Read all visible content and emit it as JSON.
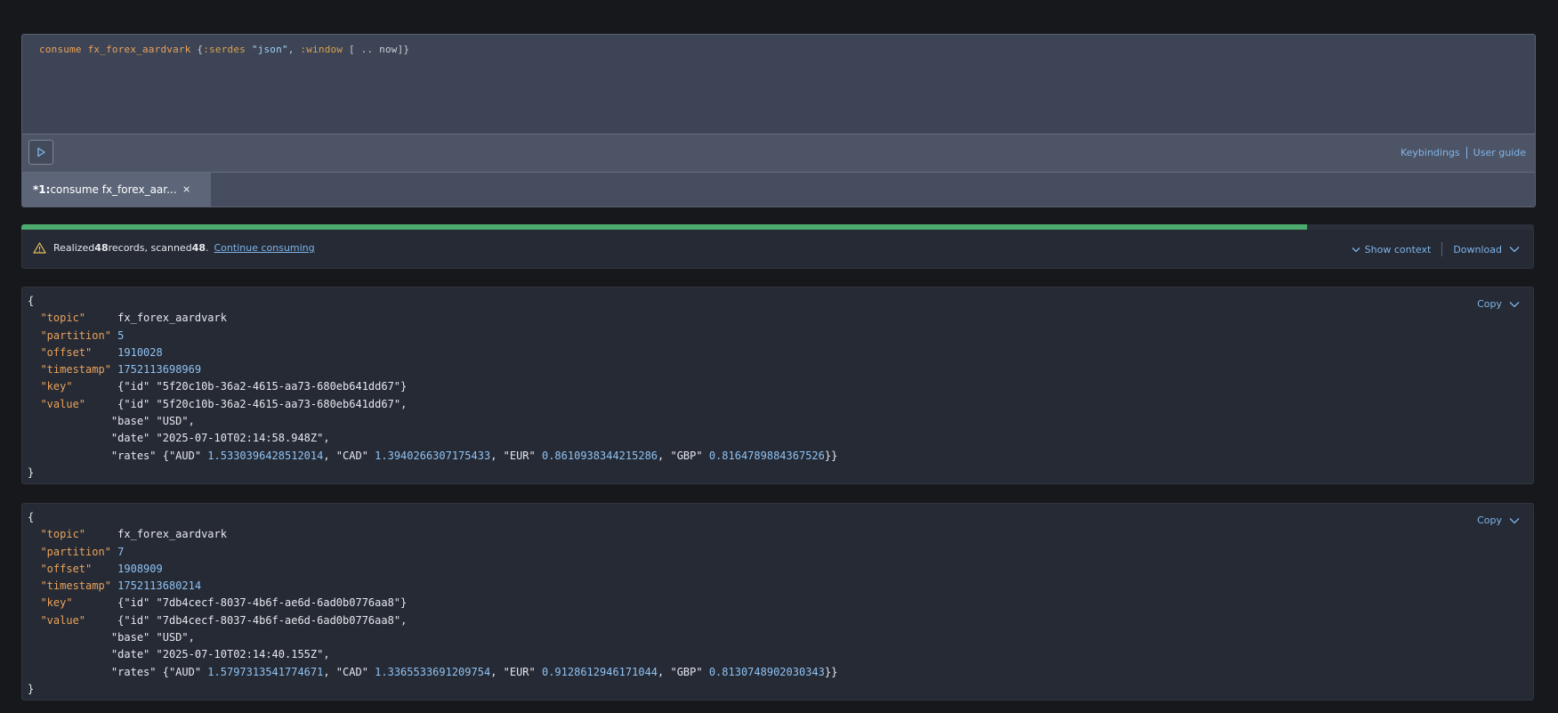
{
  "editor": {
    "query": {
      "kw": "consume fx_forex_aardvark",
      "open": " {",
      "serdes_key": ":serdes",
      "serdes_val": "\"json\"",
      "comma": ", ",
      "window_key": ":window",
      "window_val": " [ .. now]",
      "close": "}"
    },
    "run_icon": "play-icon",
    "links": {
      "keybindings": "Keybindings",
      "user_guide": "User guide"
    },
    "tab": {
      "prefix": "*1:",
      "label": " consume fx_forex_aar...",
      "close": "×"
    }
  },
  "progress": {
    "fraction": 0.85,
    "color": "#4caa6e"
  },
  "status": {
    "text_realized": "Realized ",
    "realized": "48",
    "text_scanned": " records, scanned ",
    "scanned": "48",
    "text_end": ".",
    "continue": "Continue consuming",
    "show_context": "Show context",
    "download": "Download"
  },
  "records": [
    {
      "copy": "Copy",
      "topic": "fx_forex_aardvark",
      "partition": "5",
      "offset": "1910028",
      "timestamp": "1752113698969",
      "key_id": "\"5f20c10b-36a2-4615-aa73-680eb641dd67\"",
      "value_id": "\"5f20c10b-36a2-4615-aa73-680eb641dd67\"",
      "base": "\"USD\"",
      "date": "\"2025-07-10T02:14:58.948Z\"",
      "aud": "1.5330396428512014",
      "cad": "1.3940266307175433",
      "eur": "0.8610938344215286",
      "gbp": "0.8164789884367526"
    },
    {
      "copy": "Copy",
      "topic": "fx_forex_aardvark",
      "partition": "7",
      "offset": "1908909",
      "timestamp": "1752113680214",
      "key_id": "\"7db4cecf-8037-4b6f-ae6d-6ad0b0776aa8\"",
      "value_id": "\"7db4cecf-8037-4b6f-ae6d-6ad0b0776aa8\"",
      "base": "\"USD\"",
      "date": "\"2025-07-10T02:14:40.155Z\"",
      "aud": "1.5797313541774671",
      "cad": "1.3365533691209754",
      "eur": "0.9128612946171044",
      "gbp": "0.8130748902030343"
    }
  ]
}
